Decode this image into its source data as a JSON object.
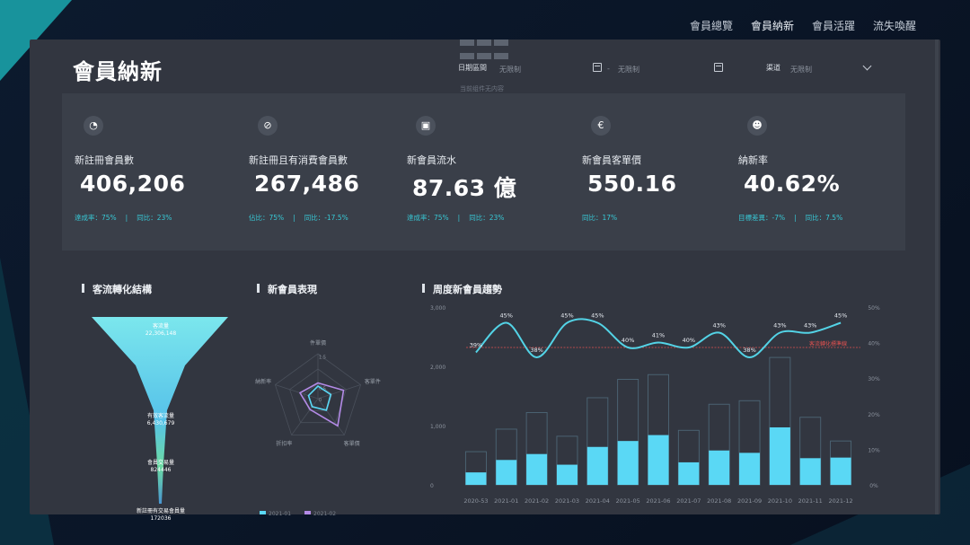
{
  "nav": {
    "tabs": [
      "會員總覽",
      "會員納新",
      "會員活躍",
      "流失喚醒"
    ],
    "active_index": 1
  },
  "page": {
    "title": "會員納新"
  },
  "filters": {
    "date_label": "日期區間",
    "date_value": "无限制",
    "date_hint": "当前组件无内容",
    "date2_value": "无限制",
    "channel_label": "渠道",
    "channel_value": "无限制"
  },
  "kpis": [
    {
      "icon": "chart-circle-icon",
      "glyph": "◔",
      "label": "新註冊會員數",
      "value": "406,206",
      "sub": [
        "達成率：75%",
        "同比：23%"
      ]
    },
    {
      "icon": "link-circle-icon",
      "glyph": "⊘",
      "label": "新註冊且有消費會員數",
      "value": "267,486",
      "sub": [
        "佔比：75%",
        "同比：-17.5%"
      ]
    },
    {
      "icon": "wallet-icon",
      "glyph": "▣",
      "label": "新會員流水",
      "value": "87.63 億",
      "sub": [
        "達成率：75%",
        "同比：23%"
      ]
    },
    {
      "icon": "currency-icon",
      "glyph": "€",
      "label": "新會員客單價",
      "value": "550.16",
      "sub": [
        "同比：17%"
      ]
    },
    {
      "icon": "users-icon",
      "glyph": "☻",
      "label": "納新率",
      "value": "40.62%",
      "sub": [
        "目標差異：-7%",
        "同比：7.5%"
      ]
    }
  ],
  "sections": {
    "funnel_title": "客流轉化結構",
    "radar_title": "新會員表現",
    "trend_title": "周度新會員趨勢"
  },
  "colors": {
    "accent": "#19c0cf",
    "bar": "#5ad8f5",
    "line": "#53d3e6",
    "radar_purple": "#b38ae6",
    "target": "#e0514f"
  },
  "chart_data": [
    {
      "type": "funnel",
      "stages": [
        {
          "label": "客流量",
          "value": "22,306,148"
        },
        {
          "label": "有效客流量",
          "value": "6,430,679"
        },
        {
          "label": "會員交易量",
          "value": "824446"
        },
        {
          "label": "新註冊有交易會員量",
          "value": "172036"
        }
      ]
    },
    {
      "type": "radar",
      "axes": [
        "件單價",
        "客單件",
        "客單價",
        "折扣率",
        "納新率"
      ],
      "ring_labels": [
        "1.5",
        "0.5",
        "0"
      ],
      "series": [
        {
          "name": "2021-01",
          "color": "#5ad8f5",
          "values": [
            0.28,
            0.3,
            0.32,
            0.22,
            0.22
          ]
        },
        {
          "name": "2021-02",
          "color": "#b38ae6",
          "values": [
            0.35,
            0.6,
            0.75,
            0.3,
            0.42
          ]
        }
      ],
      "legend": [
        "2021-01",
        "2021-02"
      ]
    },
    {
      "type": "bar-line",
      "categories": [
        "2020-53",
        "2021-01",
        "2021-02",
        "2021-03",
        "2021-04",
        "2021-05",
        "2021-06",
        "2021-07",
        "2021-08",
        "2021-09",
        "2021-10",
        "2021-11",
        "2021-12"
      ],
      "y_left_ticks": [
        "3,000",
        "2,000",
        "1,000",
        "0"
      ],
      "y_left_max": 3000,
      "y_right_ticks": [
        "50%",
        "40%",
        "30%",
        "20%",
        "10%",
        "0%"
      ],
      "y_right_max": 50,
      "bars_total": [
        560,
        940,
        1220,
        820,
        1470,
        1780,
        1860,
        920,
        1360,
        1420,
        2150,
        1140,
        740
      ],
      "bars_filled": [
        210,
        420,
        520,
        340,
        640,
        740,
        840,
        380,
        580,
        540,
        970,
        450,
        460
      ],
      "line": [
        39,
        45,
        38,
        45,
        45,
        40,
        41,
        40,
        43,
        38,
        43,
        43,
        45
      ],
      "line_labels": [
        "39%",
        "45%",
        "38%",
        "45%",
        "45%",
        "40%",
        "41%",
        "40%",
        "43%",
        "38%",
        "43%",
        "43%",
        "45%"
      ],
      "target": 40,
      "target_label": "客流轉化標準線"
    }
  ]
}
